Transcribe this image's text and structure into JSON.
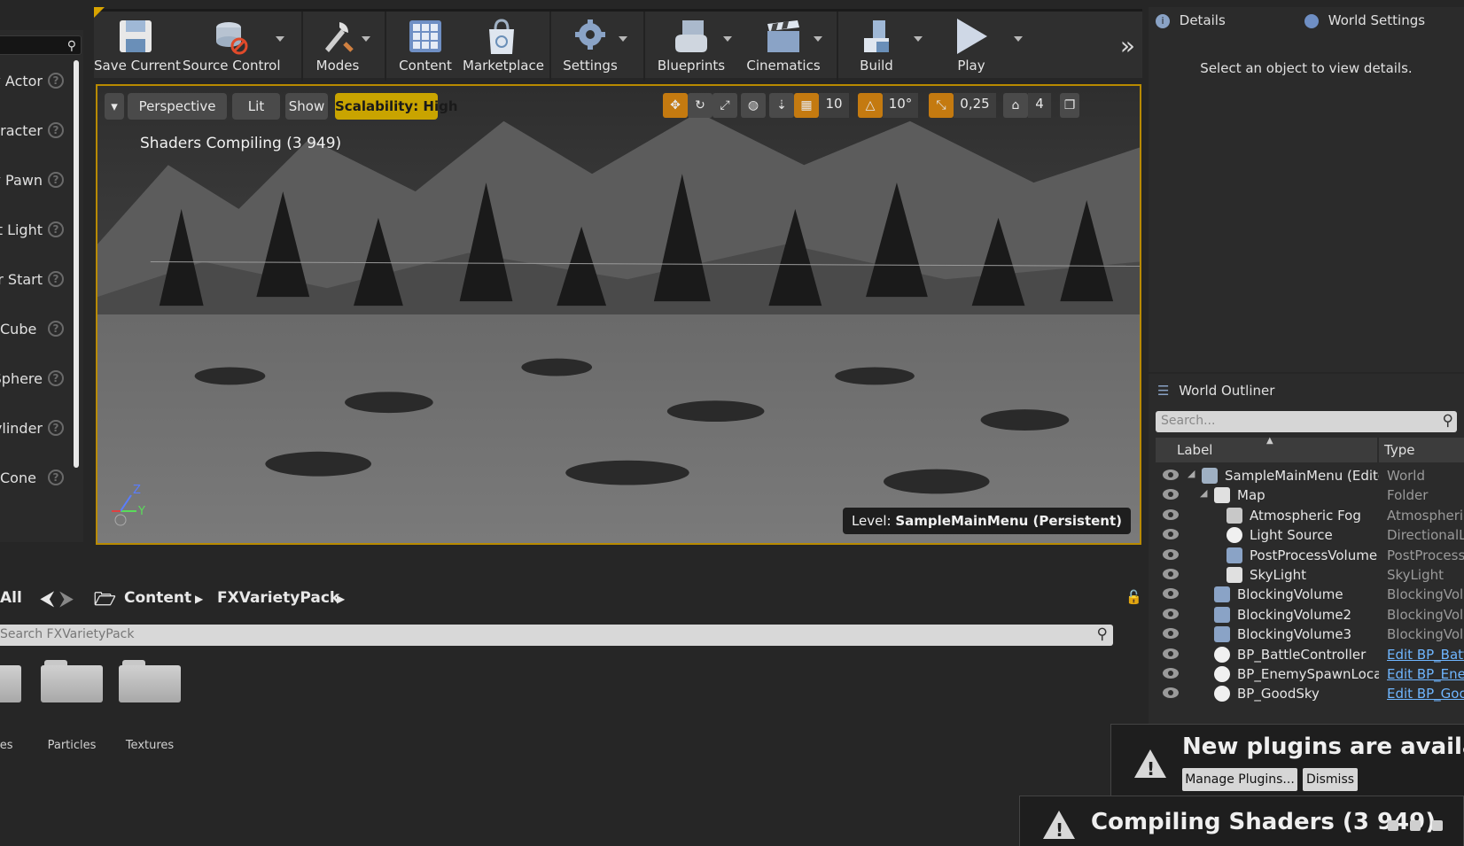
{
  "palette": {
    "items": [
      {
        "label": "Empty Actor"
      },
      {
        "label": "Empty Character"
      },
      {
        "label": "Empty Pawn"
      },
      {
        "label": "Point Light"
      },
      {
        "label": "Player Start"
      },
      {
        "label": "Cube"
      },
      {
        "label": "Sphere"
      },
      {
        "label": "Cylinder"
      },
      {
        "label": "Cone"
      }
    ],
    "help_glyph": "?"
  },
  "toolbar": {
    "save_current": "Save Current",
    "source_control": "Source Control",
    "modes": "Modes",
    "content": "Content",
    "marketplace": "Marketplace",
    "settings": "Settings",
    "blueprints": "Blueprints",
    "cinematics": "Cinematics",
    "build": "Build",
    "play": "Play",
    "more": "»"
  },
  "viewport": {
    "perspective": "Perspective",
    "lit": "Lit",
    "show": "Show",
    "scalability": "Scalability: High",
    "grid_snap": "10",
    "rotation_snap": "10°",
    "scale_snap": "0,25",
    "camera_speed": "4",
    "compiling": "Shaders Compiling (3 949)",
    "level_prefix": "Level:",
    "level_name": "SampleMainMenu (Persistent)",
    "axis_z": "Z",
    "axis_y": "Y"
  },
  "content_browser": {
    "filter_all": "All",
    "path": [
      "Content",
      "FXVarietyPack"
    ],
    "search_placeholder": "Search FXVarietyPack",
    "folders": [
      "Meshes",
      "Particles",
      "Textures"
    ]
  },
  "details": {
    "tab_details": "Details",
    "tab_world_settings": "World Settings",
    "empty_message": "Select an object to view details."
  },
  "outliner": {
    "tab": "World Outliner",
    "search_placeholder": "Search...",
    "col_label": "Label",
    "col_type": "Type",
    "rows": [
      {
        "label": "SampleMainMenu (Editor)",
        "type": "World",
        "icon": "world-icon",
        "link": false
      },
      {
        "label": "Map",
        "type": "Folder",
        "icon": "folder-icon",
        "link": false
      },
      {
        "label": "Atmospheric Fog",
        "type": "AtmosphericFog",
        "icon": "fog-icon",
        "link": false
      },
      {
        "label": "Light Source",
        "type": "DirectionalLight",
        "icon": "sun-icon",
        "link": false
      },
      {
        "label": "PostProcessVolume",
        "type": "PostProcessVolume",
        "icon": "volume-icon",
        "link": false
      },
      {
        "label": "SkyLight",
        "type": "SkyLight",
        "icon": "skylight-icon",
        "link": false
      },
      {
        "label": "BlockingVolume",
        "type": "BlockingVolume",
        "icon": "volume-icon",
        "link": false
      },
      {
        "label": "BlockingVolume2",
        "type": "BlockingVolume",
        "icon": "volume-icon",
        "link": false
      },
      {
        "label": "BlockingVolume3",
        "type": "BlockingVolume",
        "icon": "volume-icon",
        "link": false
      },
      {
        "label": "BP_BattleController",
        "type": "Edit BP_BattleController",
        "icon": "blueprint-icon",
        "link": true
      },
      {
        "label": "BP_EnemySpawnLocation",
        "type": "Edit BP_EnemySpawnLocation",
        "icon": "blueprint-icon",
        "link": true
      },
      {
        "label": "BP_GoodSky",
        "type": "Edit BP_GoodSky",
        "icon": "blueprint-icon",
        "link": true
      }
    ]
  },
  "notifications": {
    "plugins_title": "New plugins are available",
    "manage_plugins": "Manage Plugins...",
    "dismiss": "Dismiss",
    "compiling_title": "Compiling Shaders (3 949)",
    "warn_glyph": "!"
  },
  "colors": {
    "accent": "#d9a400",
    "scalability_bg": "#c9a400",
    "link": "#6fb6ff"
  }
}
